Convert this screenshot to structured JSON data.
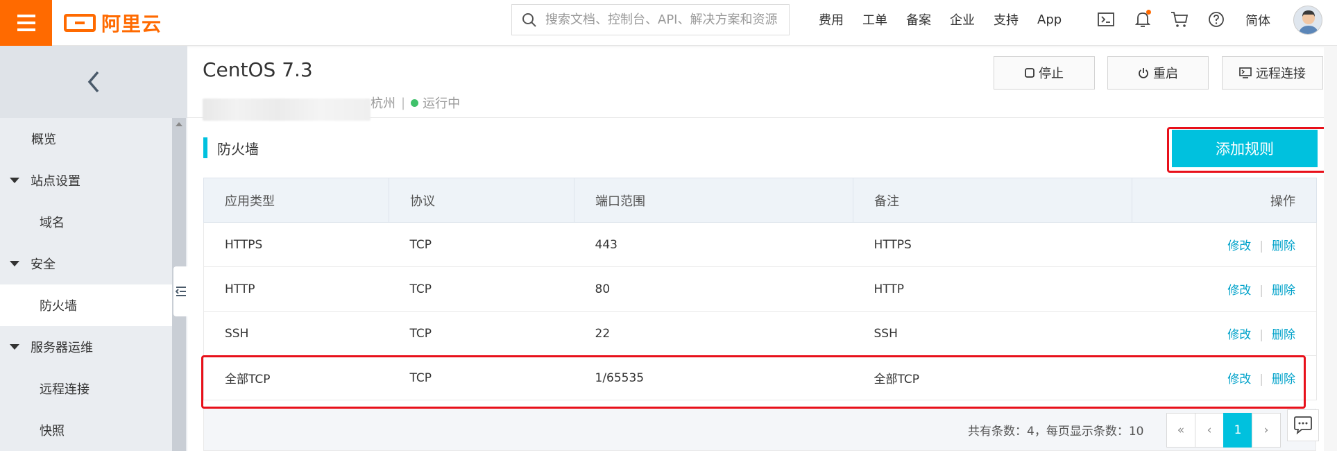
{
  "brand": {
    "logo_text": "阿里云",
    "accent": "#ff6a00",
    "primary": "#00c1de"
  },
  "search": {
    "placeholder": "搜索文档、控制台、API、解决方案和资源"
  },
  "topnav": {
    "items": [
      "费用",
      "工单",
      "备案",
      "企业",
      "支持",
      "App"
    ]
  },
  "top_icons": [
    "terminal-icon",
    "bell-icon",
    "cart-icon",
    "help-icon"
  ],
  "lang_label": "简体",
  "sidebar": {
    "items": [
      {
        "label": "概览",
        "kind": "top"
      },
      {
        "label": "站点设置",
        "kind": "group"
      },
      {
        "label": "域名",
        "kind": "sub"
      },
      {
        "label": "安全",
        "kind": "group"
      },
      {
        "label": "防火墙",
        "kind": "sub",
        "active": true
      },
      {
        "label": "服务器运维",
        "kind": "group"
      },
      {
        "label": "远程连接",
        "kind": "sub"
      },
      {
        "label": "快照",
        "kind": "sub"
      }
    ]
  },
  "instance": {
    "title": "CentOS 7.3",
    "region": "杭州",
    "separator": "|",
    "status": "运行中",
    "status_color": "#3fc16a"
  },
  "actions": {
    "stop": "停止",
    "restart": "重启",
    "remote": "远程连接"
  },
  "firewall": {
    "section_title": "防火墙",
    "add_rule": "添加规则",
    "columns": [
      "应用类型",
      "协议",
      "端口范围",
      "备注",
      "操作"
    ],
    "rows": [
      {
        "app": "HTTPS",
        "protocol": "TCP",
        "port": "443",
        "note": "HTTPS"
      },
      {
        "app": "HTTP",
        "protocol": "TCP",
        "port": "80",
        "note": "HTTP"
      },
      {
        "app": "SSH",
        "protocol": "TCP",
        "port": "22",
        "note": "SSH"
      },
      {
        "app": "全部TCP",
        "protocol": "TCP",
        "port": "1/65535",
        "note": "全部TCP"
      }
    ],
    "edit_label": "修改",
    "delete_label": "删除",
    "op_separator": "|"
  },
  "pagination": {
    "summary": "共有条数：4，每页显示条数：10",
    "first": "«",
    "prev": "‹",
    "current_page": "1",
    "next": "›"
  }
}
